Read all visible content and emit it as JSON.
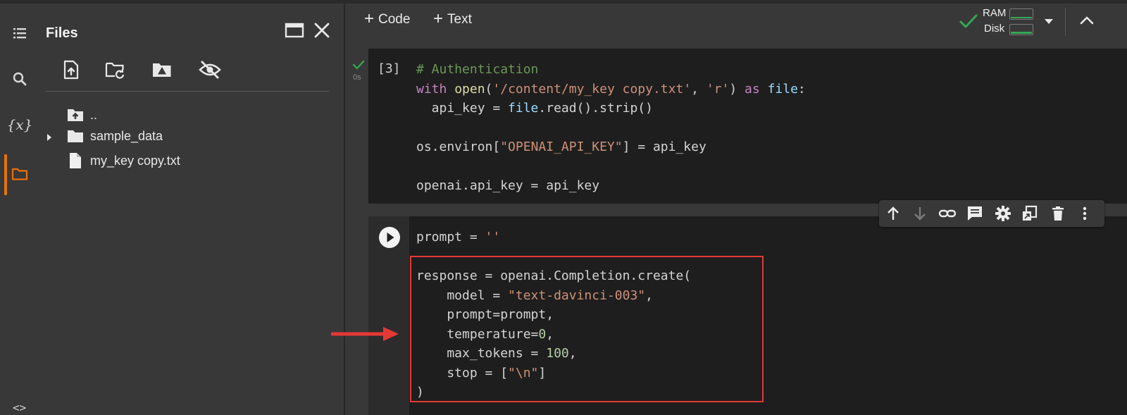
{
  "rail": {
    "icons": [
      "table-of-contents-icon",
      "search-icon",
      "variables-icon",
      "folder-icon"
    ],
    "variables_glyph": "{x}"
  },
  "files_panel": {
    "title": "Files",
    "header_icons": [
      "open-in-tab-icon",
      "close-icon"
    ],
    "toolbar_icons": [
      "upload-file-icon",
      "refresh-icon",
      "mount-drive-icon",
      "hide-files-icon"
    ],
    "tree": [
      {
        "label": "..",
        "icon": "folder-up-icon"
      },
      {
        "label": "sample_data",
        "icon": "folder-icon",
        "expandable": true
      },
      {
        "label": "my_key copy.txt",
        "icon": "file-icon"
      }
    ]
  },
  "toolbar": {
    "code_label": "Code",
    "text_label": "Text",
    "ram_label": "RAM",
    "disk_label": "Disk",
    "status_color": "#34a853"
  },
  "cell1": {
    "exec_count": "[3]",
    "run_time": "0s",
    "lines": [
      [
        {
          "t": "# Authentication",
          "c": "cm"
        }
      ],
      [
        {
          "t": "with ",
          "c": "kw"
        },
        {
          "t": "open",
          "c": "fn"
        },
        {
          "t": "(",
          "c": ""
        },
        {
          "t": "'/content/my_key copy.txt'",
          "c": "st"
        },
        {
          "t": ", ",
          "c": ""
        },
        {
          "t": "'r'",
          "c": "st"
        },
        {
          "t": ") ",
          "c": ""
        },
        {
          "t": "as ",
          "c": "kw"
        },
        {
          "t": "file",
          "c": "vr"
        },
        {
          "t": ":",
          "c": ""
        }
      ],
      [
        {
          "t": "  api_key = ",
          "c": ""
        },
        {
          "t": "file",
          "c": "vr"
        },
        {
          "t": ".read().strip()",
          "c": ""
        }
      ],
      [
        {
          "t": "",
          "c": ""
        }
      ],
      [
        {
          "t": "os.environ[",
          "c": ""
        },
        {
          "t": "\"OPENAI_API_KEY\"",
          "c": "st"
        },
        {
          "t": "] = api_key",
          "c": ""
        }
      ],
      [
        {
          "t": "",
          "c": ""
        }
      ],
      [
        {
          "t": "openai.api_key = api_key",
          "c": ""
        }
      ]
    ]
  },
  "cell2": {
    "lines": [
      [
        {
          "t": "prompt = ",
          "c": ""
        },
        {
          "t": "''",
          "c": "st"
        }
      ],
      [
        {
          "t": "",
          "c": ""
        }
      ],
      [
        {
          "t": "response = openai.Completion.create(",
          "c": ""
        }
      ],
      [
        {
          "t": "    model = ",
          "c": ""
        },
        {
          "t": "\"text-davinci-003\"",
          "c": "st"
        },
        {
          "t": ",",
          "c": ""
        }
      ],
      [
        {
          "t": "    prompt=prompt,",
          "c": ""
        }
      ],
      [
        {
          "t": "    temperature=",
          "c": ""
        },
        {
          "t": "0",
          "c": "nm"
        },
        {
          "t": ",",
          "c": ""
        }
      ],
      [
        {
          "t": "    max_tokens = ",
          "c": ""
        },
        {
          "t": "100",
          "c": "nm"
        },
        {
          "t": ",",
          "c": ""
        }
      ],
      [
        {
          "t": "    stop = [",
          "c": ""
        },
        {
          "t": "\"\\n\"",
          "c": "st"
        },
        {
          "t": "]",
          "c": ""
        }
      ],
      [
        {
          "t": ")",
          "c": ""
        }
      ]
    ]
  },
  "cell_actions": [
    "move-up-icon",
    "move-down-icon",
    "link-icon",
    "comment-icon",
    "settings-icon",
    "mirror-cell-icon",
    "delete-icon",
    "more-icon"
  ],
  "annotation": {
    "color": "#e53935"
  }
}
